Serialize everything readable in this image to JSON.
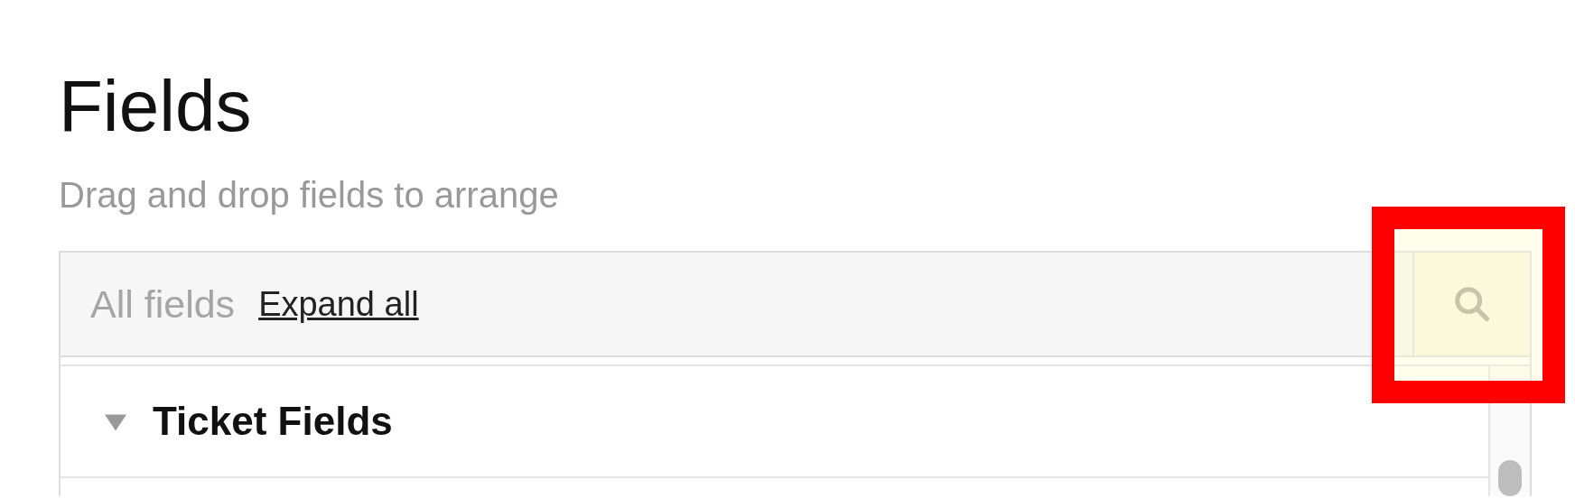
{
  "page": {
    "title": "Fields",
    "subtitle": "Drag and drop fields to arrange"
  },
  "toolbar": {
    "label": "All fields",
    "link": "Expand all",
    "search_button": {
      "highlighted": true
    }
  },
  "tree": [
    {
      "label": "Ticket Fields",
      "expanded": true
    }
  ]
}
